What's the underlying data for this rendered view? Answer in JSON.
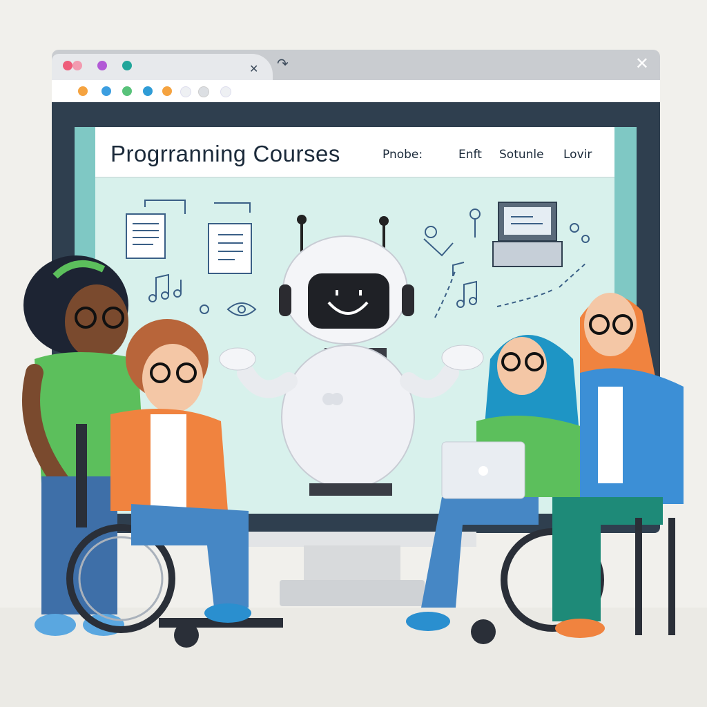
{
  "window": {
    "close_label": "✕",
    "tab_close_label": "✕"
  },
  "page": {
    "title": "Progrranning Courses",
    "nav": [
      "Pnobe:",
      "Enft",
      "Sotunle",
      "Lovir"
    ]
  },
  "colors": {
    "screen_teal": "#7fc8c4",
    "page_bg": "#d8f1ec",
    "monitor_frame": "#2f3f4f",
    "window_dots": [
      "#ee5d7a",
      "#b25ad6",
      "#21a59a"
    ],
    "toolbar_dots": [
      "#f5a340",
      "#3c9ee0",
      "#58c27a",
      "#2f9cd6",
      "#f5a340",
      "#eef0f3",
      "#dcdfe3",
      "#eef0f3"
    ]
  },
  "icons": [
    "document-icon",
    "notebook-icon",
    "music-note-icon",
    "laptop-icon",
    "robot-mascot",
    "eye-icon",
    "gear-icon",
    "arrow-icon"
  ]
}
